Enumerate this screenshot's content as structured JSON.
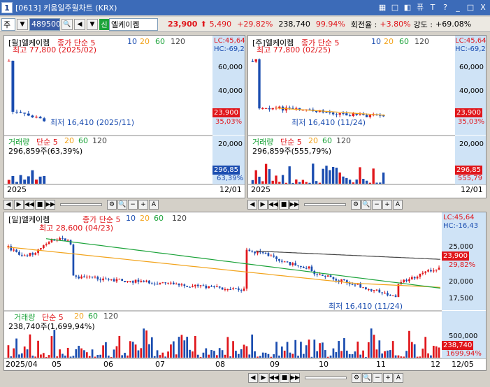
{
  "window": {
    "number": "1",
    "title": "[0613] 키움일주월차트 (KRX)",
    "buttons": [
      "▦",
      "□",
      "◧",
      "퓨",
      "T",
      "?",
      "_",
      "□",
      "X"
    ]
  },
  "toolbar": {
    "market": "주",
    "code": "489500",
    "badge": "신",
    "name": "엘케이켐",
    "price": "23,900",
    "change": "5,490",
    "change_pct": "+29.82%",
    "volume": "238,740",
    "volume_ratio": "99.94%",
    "turnover_label": "회전율 :",
    "turnover": "+3.80%",
    "strength_label": "강도 :",
    "strength": "+69.08%"
  },
  "colors": {
    "up": "#e0161b",
    "down": "#1b4db0",
    "ma5": "#e0161b",
    "ma10": "#1b4db0",
    "ma20": "#f2a31b",
    "ma60": "#1ca33a",
    "ma120": "#444444"
  },
  "monthly": {
    "title": "[월]엘케이켐",
    "legend": [
      "종가 단순 5",
      "10",
      "20",
      "60",
      "120"
    ],
    "high_label": "최고 77,800 (2025/02)",
    "low_label": "최저 16,410 (2025/11)",
    "lc": "LC:45,64",
    "hc": "HC:-69,2",
    "ticks": [
      "60,000",
      "40,000",
      "20,000"
    ],
    "price_tag": "23,900",
    "pct_tag": "35,03%",
    "vol_title": "거래량",
    "vol_legend": [
      "단순 5",
      "20",
      "60",
      "120"
    ],
    "vol_value": "296,859주(63,39%)",
    "vol_ticks": [
      "20,000"
    ],
    "vol_tag": "296,85",
    "vol_pct": "63,39%",
    "date_left": "2025",
    "date_right": "12/01"
  },
  "weekly": {
    "title": "[주]엘케이켐",
    "legend": [
      "종가 단순 5",
      "10",
      "20",
      "60",
      "120"
    ],
    "high_label": "최고 77,800 (02/25)",
    "low_label": "최저 16,410 (11/24)",
    "lc": "LC:45,64",
    "hc": "HC:-69,2",
    "ticks": [
      "60,000",
      "40,000",
      "20,000"
    ],
    "price_tag": "23,900",
    "pct_tag": "35,03%",
    "vol_title": "거래량",
    "vol_legend": [
      "단순 5",
      "20",
      "60",
      "120"
    ],
    "vol_value": "296,859주(555,79%)",
    "vol_ticks": [
      "20,000"
    ],
    "vol_tag": "296,85",
    "vol_pct": "555,79",
    "date_left": "2025",
    "date_right": "12/01"
  },
  "daily": {
    "title": "[일]엘케이켐",
    "legend": [
      "종가 단순 5",
      "10",
      "20",
      "60",
      "120"
    ],
    "high_label": "최고 28,600 (04/23)",
    "low_label": "최저 16,410 (11/24)",
    "lc": "LC:45,64",
    "hc": "HC:-16,43",
    "ticks": [
      "25,000",
      "20,000",
      "17,500"
    ],
    "price_tag": "23,900",
    "pct_tag": "29,82%",
    "vol_title": "거래량",
    "vol_legend": [
      "단순 5",
      "20",
      "60",
      "120"
    ],
    "vol_value": "238,740주(1,699,94%)",
    "vol_ticks": [
      "500,000"
    ],
    "vol_tag": "238,740",
    "vol_pct": "1699,94%",
    "dates": [
      "2025/04",
      "05",
      "06",
      "07",
      "08",
      "09",
      "10",
      "11",
      "12"
    ],
    "date_right": "12/05"
  }
}
